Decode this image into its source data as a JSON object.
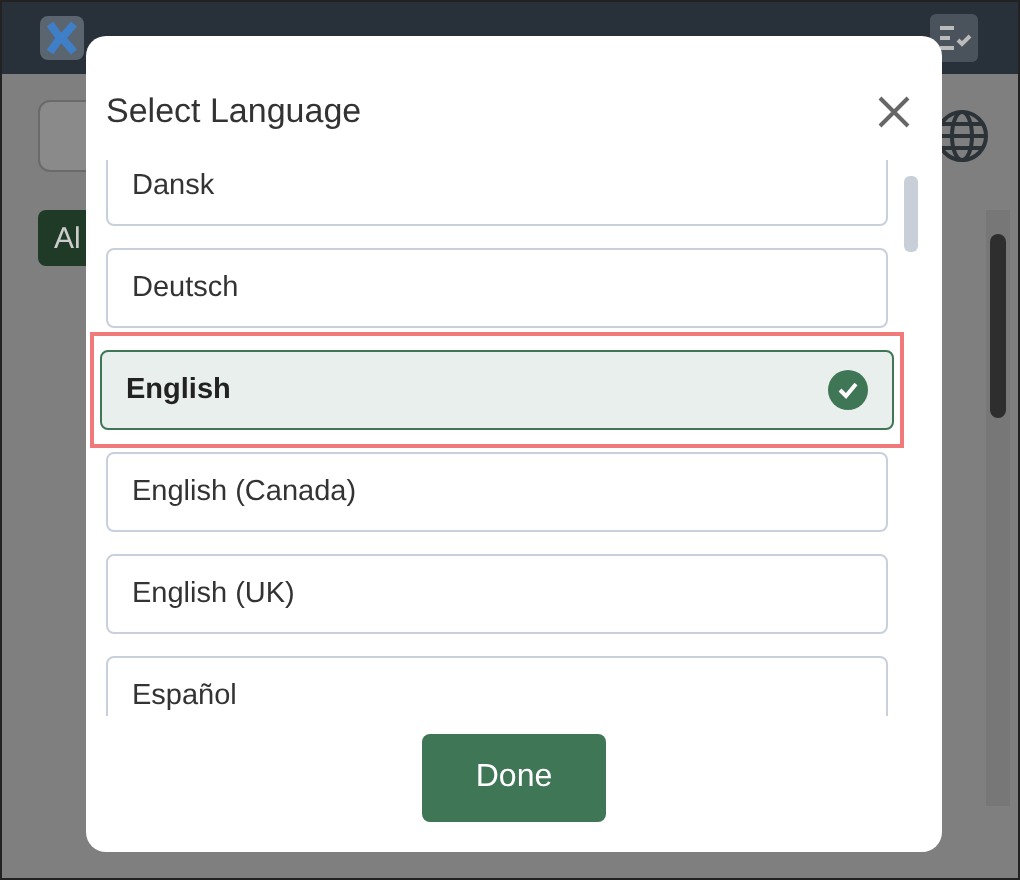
{
  "background": {
    "filter_button": "Al"
  },
  "dialog": {
    "title": "Select Language",
    "languages": [
      {
        "label": "Dansk",
        "selected": false
      },
      {
        "label": "Deutsch",
        "selected": false
      },
      {
        "label": "English",
        "selected": true
      },
      {
        "label": "English (Canada)",
        "selected": false
      },
      {
        "label": "English (UK)",
        "selected": false
      },
      {
        "label": "Español",
        "selected": false
      }
    ],
    "done_button": "Done"
  }
}
